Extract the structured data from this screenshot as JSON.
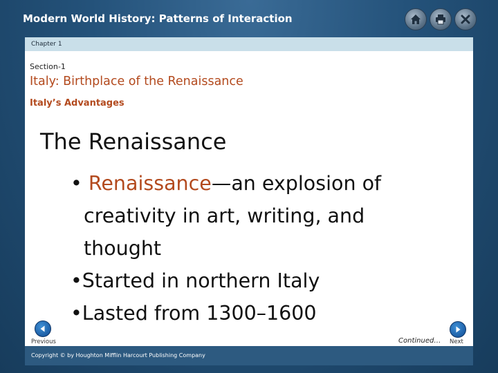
{
  "app": {
    "title": "Modern World History: Patterns of Interaction"
  },
  "toolbar": {
    "home_icon": "home-icon",
    "print_icon": "printer-icon",
    "close_icon": "close-icon"
  },
  "chapter": {
    "label": "Chapter 1"
  },
  "section": {
    "label": "Section-1",
    "title": "Italy: Birthplace of the Renaissance",
    "subsection": "Italy’s Advantages"
  },
  "slide": {
    "heading": "The Renaissance",
    "bullet1": {
      "marker": "•",
      "term": "Renaissance",
      "dash": "—",
      "line1_rest": "an explosion of",
      "line2": "creativity in art, writing, and",
      "line3": "thought"
    },
    "bullet2": "•Started in northern Italy",
    "bullet3": "•Lasted from 1300–1600"
  },
  "navigation": {
    "previous_label": "Previous",
    "next_label": "Next",
    "continued_label": "Continued…"
  },
  "footer": {
    "copyright": "Copyright © by Houghton Mifflin Harcourt Publishing Company"
  },
  "colors": {
    "accent": "#b34a1e",
    "frame": "#24527a",
    "chapter_bar": "#c9dfe9"
  }
}
